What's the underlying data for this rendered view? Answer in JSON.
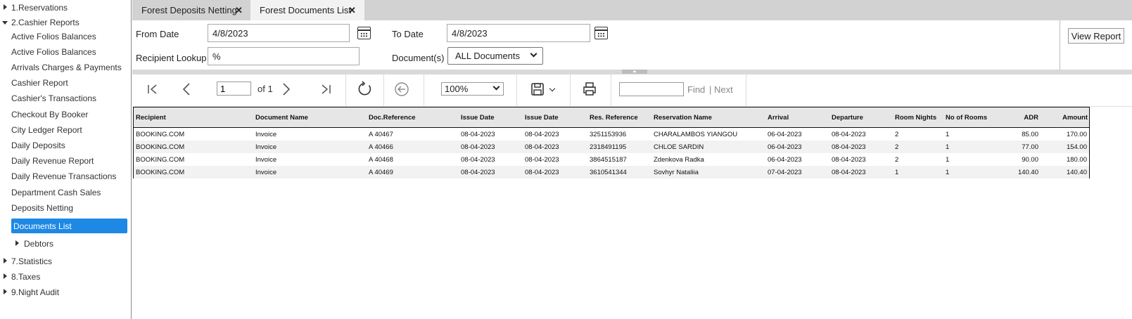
{
  "sidebar": {
    "groups": [
      {
        "label": "1.Reservations"
      },
      {
        "label": "2.Cashier Reports"
      },
      {
        "label": "7.Statistics"
      },
      {
        "label": "8.Taxes"
      },
      {
        "label": "9.Night Audit"
      }
    ],
    "cashier_items": [
      "Active Folios Balances",
      "Active Folios Balances",
      "Arrivals Charges & Payments",
      "Cashier Report",
      "Cashier's Transactions",
      "Checkout By Booker",
      "City Ledger Report",
      "Daily Deposits",
      "Daily Revenue Report",
      "Daily Revenue Transactions",
      "Department Cash Sales",
      "Deposits Netting"
    ],
    "selected": "Documents List",
    "debtors": "Debtors"
  },
  "tabs": [
    {
      "label": "Forest Deposits Netting"
    },
    {
      "label": "Forest Documents List"
    }
  ],
  "params": {
    "from_date_label": "From Date",
    "from_date_value": "4/8/2023",
    "to_date_label": "To Date",
    "to_date_value": "4/8/2023",
    "recipient_label": "Recipient Lookup",
    "recipient_value": "%",
    "documents_label": "Document(s)",
    "documents_value": "ALL Documents",
    "view_report": "View Report"
  },
  "toolbar": {
    "page_value": "1",
    "page_of": "of 1",
    "zoom": "100%",
    "find": "Find",
    "separator": "|",
    "next": "Next"
  },
  "report": {
    "headers": [
      "Recipient",
      "Document Name",
      "Doc.Reference",
      "Issue Date",
      "Issue Date",
      "Res. Reference",
      "Reservation Name",
      "Arrival",
      "Departure",
      "Room Nights",
      "No of Rooms",
      "ADR",
      "Amount"
    ],
    "rows": [
      [
        "BOOKING.COM",
        "Invoice",
        "A 40467",
        "08-04-2023",
        "08-04-2023",
        "3251153936",
        "CHARALAMBOS YIANGOU",
        "06-04-2023",
        "08-04-2023",
        "2",
        "1",
        "85.00",
        "170.00"
      ],
      [
        "BOOKING.COM",
        "Invoice",
        "A 40466",
        "08-04-2023",
        "08-04-2023",
        "2318491195",
        "CHLOE SARDIN",
        "06-04-2023",
        "08-04-2023",
        "2",
        "1",
        "77.00",
        "154.00"
      ],
      [
        "BOOKING.COM",
        "Invoice",
        "A 40468",
        "08-04-2023",
        "08-04-2023",
        "3864515187",
        "Zdenkova Radka",
        "06-04-2023",
        "08-04-2023",
        "2",
        "1",
        "90.00",
        "180.00"
      ],
      [
        "BOOKING.COM",
        "Invoice",
        "A 40469",
        "08-04-2023",
        "08-04-2023",
        "3610541344",
        "Sovhyr Nataliia",
        "07-04-2023",
        "08-04-2023",
        "1",
        "1",
        "140.40",
        "140.40"
      ]
    ]
  },
  "colors": {
    "selected_bg": "#1e88e5",
    "tabbar_bg": "#d2d2d2",
    "active_tab_bg": "#f2f2f2"
  }
}
